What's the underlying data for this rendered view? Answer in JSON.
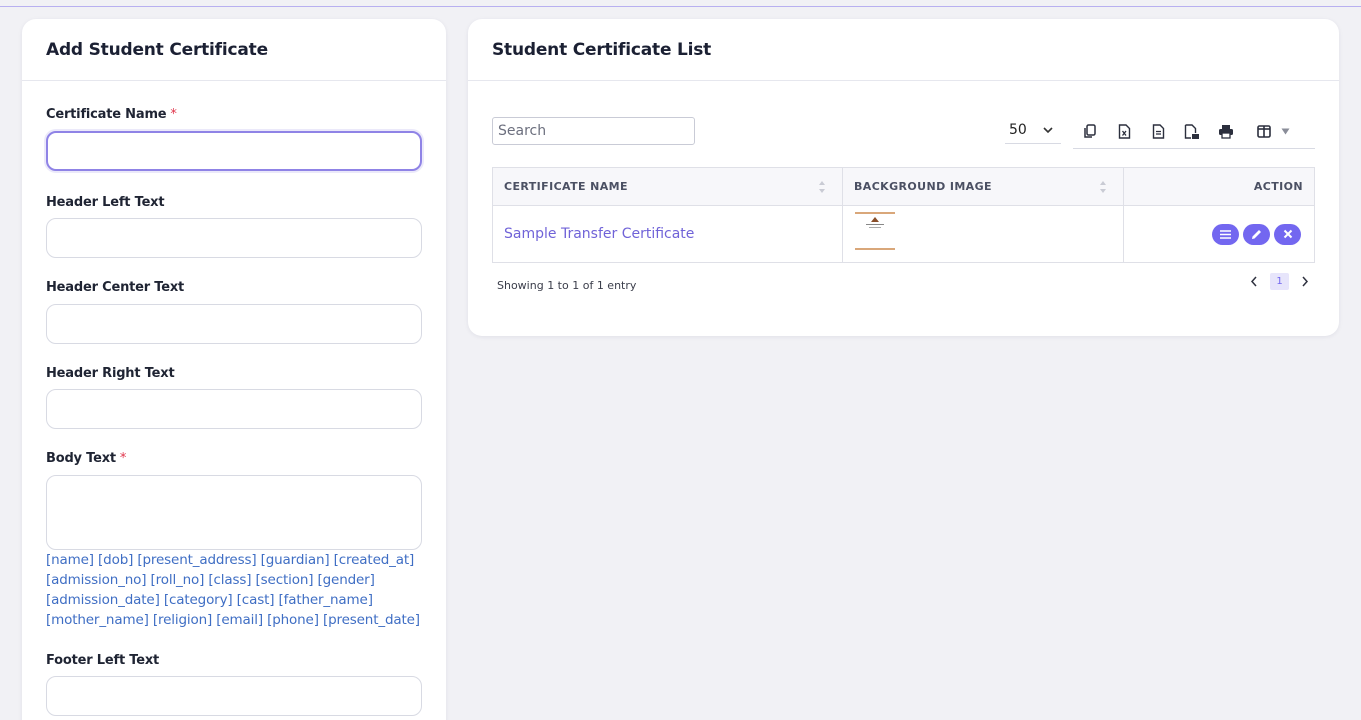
{
  "add_form": {
    "title": "Add Student Certificate",
    "fields": {
      "certificate_name": {
        "label": "Certificate Name",
        "required": "*"
      },
      "header_left": {
        "label": "Header Left Text"
      },
      "header_center": {
        "label": "Header Center Text"
      },
      "header_right": {
        "label": "Header Right Text"
      },
      "body_text": {
        "label": "Body Text",
        "required": "*"
      },
      "footer_left": {
        "label": "Footer Left Text"
      }
    },
    "placeholders_text": "[name] [dob] [present_address] [guardian] [created_at] [admission_no] [roll_no] [class] [section] [gender] [admission_date] [category] [cast] [father_name] [mother_name] [religion] [email] [phone] [present_date]"
  },
  "list": {
    "title": "Student Certificate List",
    "search_placeholder": "Search",
    "page_length": "50",
    "columns": {
      "name": "CERTIFICATE NAME",
      "background": "BACKGROUND IMAGE",
      "action": "ACTION"
    },
    "rows": [
      {
        "name": "Sample Transfer Certificate"
      }
    ],
    "info": "Showing 1 to 1 of 1 entry",
    "current_page": "1"
  },
  "colors": {
    "accent": "#7367f0",
    "link": "#7063d8",
    "required": "#e0354b",
    "placeholder_link": "#3f6ec4"
  },
  "icons": [
    "copy-icon",
    "excel-icon",
    "csv-icon",
    "pdf-icon",
    "print-icon",
    "columns-icon",
    "caret-down-icon",
    "chevron-down-icon",
    "list-icon",
    "edit-icon",
    "close-icon",
    "sort-icon",
    "chevron-left-icon",
    "chevron-right-icon"
  ]
}
